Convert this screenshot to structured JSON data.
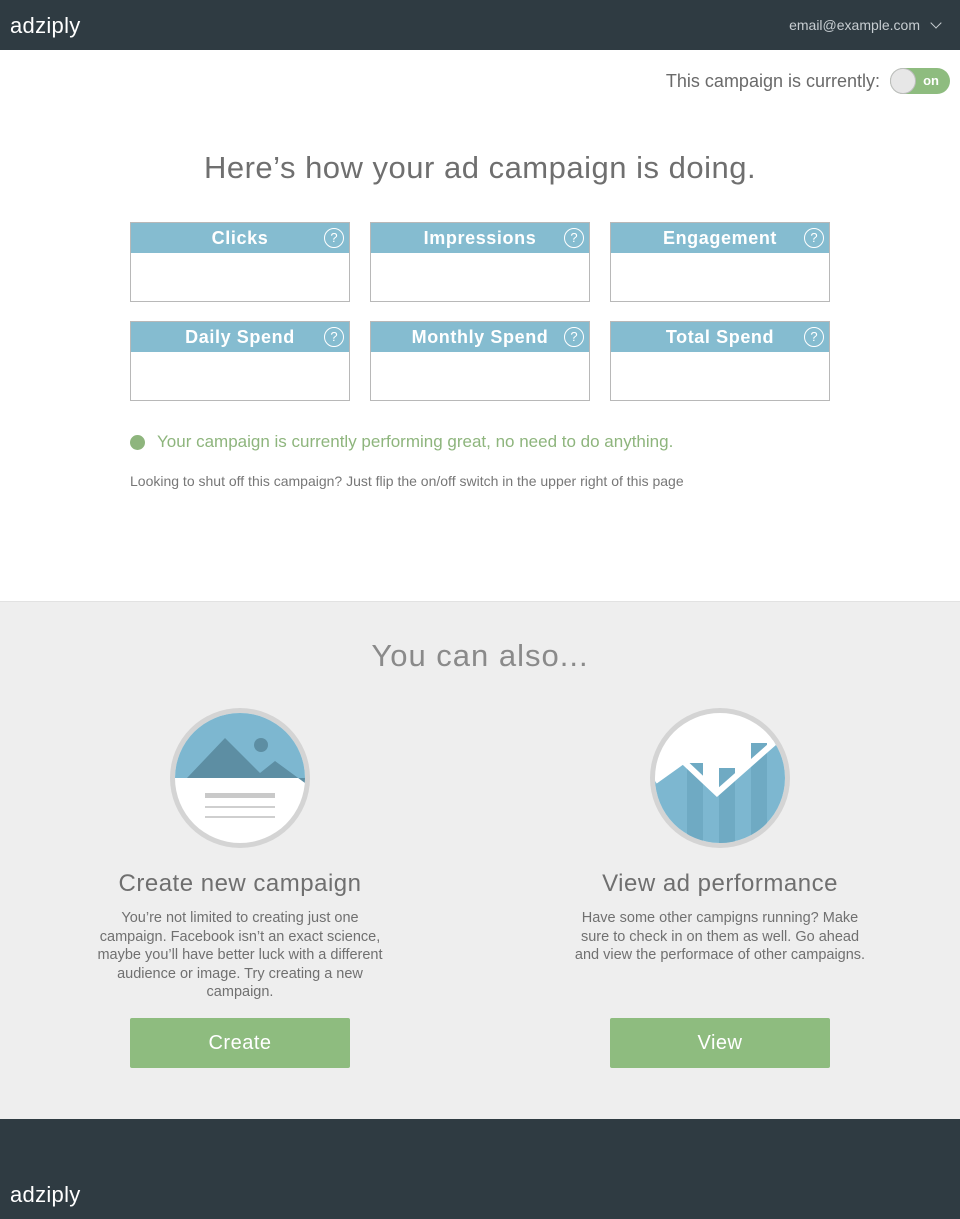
{
  "brand": "adzipl y",
  "header": {
    "logo": "adziply",
    "account_email": "email@example.com"
  },
  "campaign_status": {
    "label": "This campaign is currently:",
    "toggle_text": "on",
    "is_on": true
  },
  "headline": "Here’s how your ad campaign is doing.",
  "metrics": [
    {
      "label": "Clicks",
      "value": ""
    },
    {
      "label": "Impressions",
      "value": ""
    },
    {
      "label": "Engagement",
      "value": ""
    },
    {
      "label": "Daily Spend",
      "value": ""
    },
    {
      "label": "Monthly Spend",
      "value": ""
    },
    {
      "label": "Total Spend",
      "value": ""
    }
  ],
  "help_glyph": "?",
  "performance_message": "Your campaign is currently performing great, no need to do anything.",
  "shutoff_hint": "Looking to shut off this campaign? Just flip the on/off switch in the upper right of this page",
  "also": {
    "title": "You can also...",
    "create": {
      "title": "Create new campaign",
      "text": "You’re not limited to creating just one campaign. Facebook isn’t an exact science, maybe you’ll have better luck with a different audience or image. Try creating a new campaign.",
      "button": "Create",
      "icon": "image-placeholder-icon"
    },
    "view": {
      "title": "View ad performance",
      "text": "Have some other campigns running? Make sure to check in on them as well. Go ahead and view the performace of other campaigns.",
      "button": "View",
      "icon": "line-chart-icon"
    }
  },
  "footer": {
    "logo": "adziply"
  },
  "colors": {
    "header_bg": "#2f3b42",
    "accent_green": "#8ebc7f",
    "card_header_blue": "#85bcd0"
  }
}
